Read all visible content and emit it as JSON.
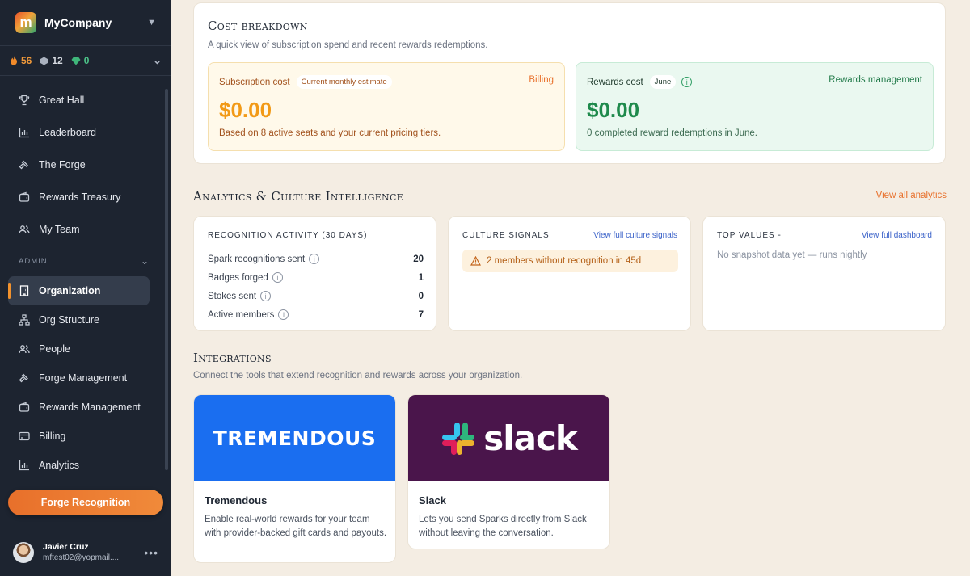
{
  "company": {
    "name": "MyCompany",
    "logo_letter": "m"
  },
  "stats": {
    "fire": "56",
    "stone": "12",
    "gem": "0"
  },
  "nav": {
    "items": [
      {
        "label": "Great Hall",
        "icon": "trophy-icon"
      },
      {
        "label": "Leaderboard",
        "icon": "bar-chart-icon"
      },
      {
        "label": "The Forge",
        "icon": "hammer-icon"
      },
      {
        "label": "Rewards Treasury",
        "icon": "wallet-icon"
      },
      {
        "label": "My Team",
        "icon": "team-icon"
      }
    ],
    "admin_label": "ADMIN",
    "admin_items": [
      {
        "label": "Organization",
        "icon": "building-icon",
        "active": true
      },
      {
        "label": "Org Structure",
        "icon": "org-chart-icon"
      },
      {
        "label": "People",
        "icon": "people-icon"
      },
      {
        "label": "Forge Management",
        "icon": "hammer-icon"
      },
      {
        "label": "Rewards Management",
        "icon": "wallet-icon"
      },
      {
        "label": "Billing",
        "icon": "credit-card-icon"
      },
      {
        "label": "Analytics",
        "icon": "bar-chart-icon"
      }
    ],
    "cta": "Forge Recognition"
  },
  "user": {
    "name": "Javier Cruz",
    "email": "mftest02@yopmail...."
  },
  "cost": {
    "title": "Cost breakdown",
    "subtitle": "A quick view of subscription spend and recent rewards redemptions.",
    "subscription": {
      "label": "Subscription cost",
      "pill": "Current monthly estimate",
      "link": "Billing",
      "amount": "$0.00",
      "note": "Based on 8 active seats and your current pricing tiers."
    },
    "rewards": {
      "label": "Rewards cost",
      "pill": "June",
      "link": "Rewards management",
      "amount": "$0.00",
      "note": "0 completed reward redemptions in June."
    }
  },
  "analytics": {
    "title": "Analytics & Culture Intelligence",
    "view_all": "View all analytics",
    "recognition": {
      "caption": "RECOGNITION ACTIVITY (30 DAYS)",
      "rows": [
        {
          "label": "Spark recognitions sent",
          "value": "20"
        },
        {
          "label": "Badges forged",
          "value": "1"
        },
        {
          "label": "Stokes sent",
          "value": "0"
        },
        {
          "label": "Active members",
          "value": "7"
        }
      ]
    },
    "culture": {
      "caption": "CULTURE SIGNALS",
      "link": "View full culture signals",
      "signal": "2 members without recognition in 45d"
    },
    "values": {
      "caption": "TOP VALUES -",
      "link": "View full dashboard",
      "empty": "No snapshot data yet — runs nightly"
    }
  },
  "integrations": {
    "title": "Integrations",
    "subtitle": "Connect the tools that extend recognition and rewards across your organization.",
    "items": [
      {
        "name": "Tremendous",
        "logo": "TREMENDOUS",
        "desc": "Enable real-world rewards for your team with provider-backed gift cards and payouts.",
        "color": "#1a6ef0"
      },
      {
        "name": "Slack",
        "logo": "slack",
        "desc": "Lets you send Sparks directly from Slack without leaving the conversation.",
        "color": "#4a154b"
      }
    ]
  }
}
